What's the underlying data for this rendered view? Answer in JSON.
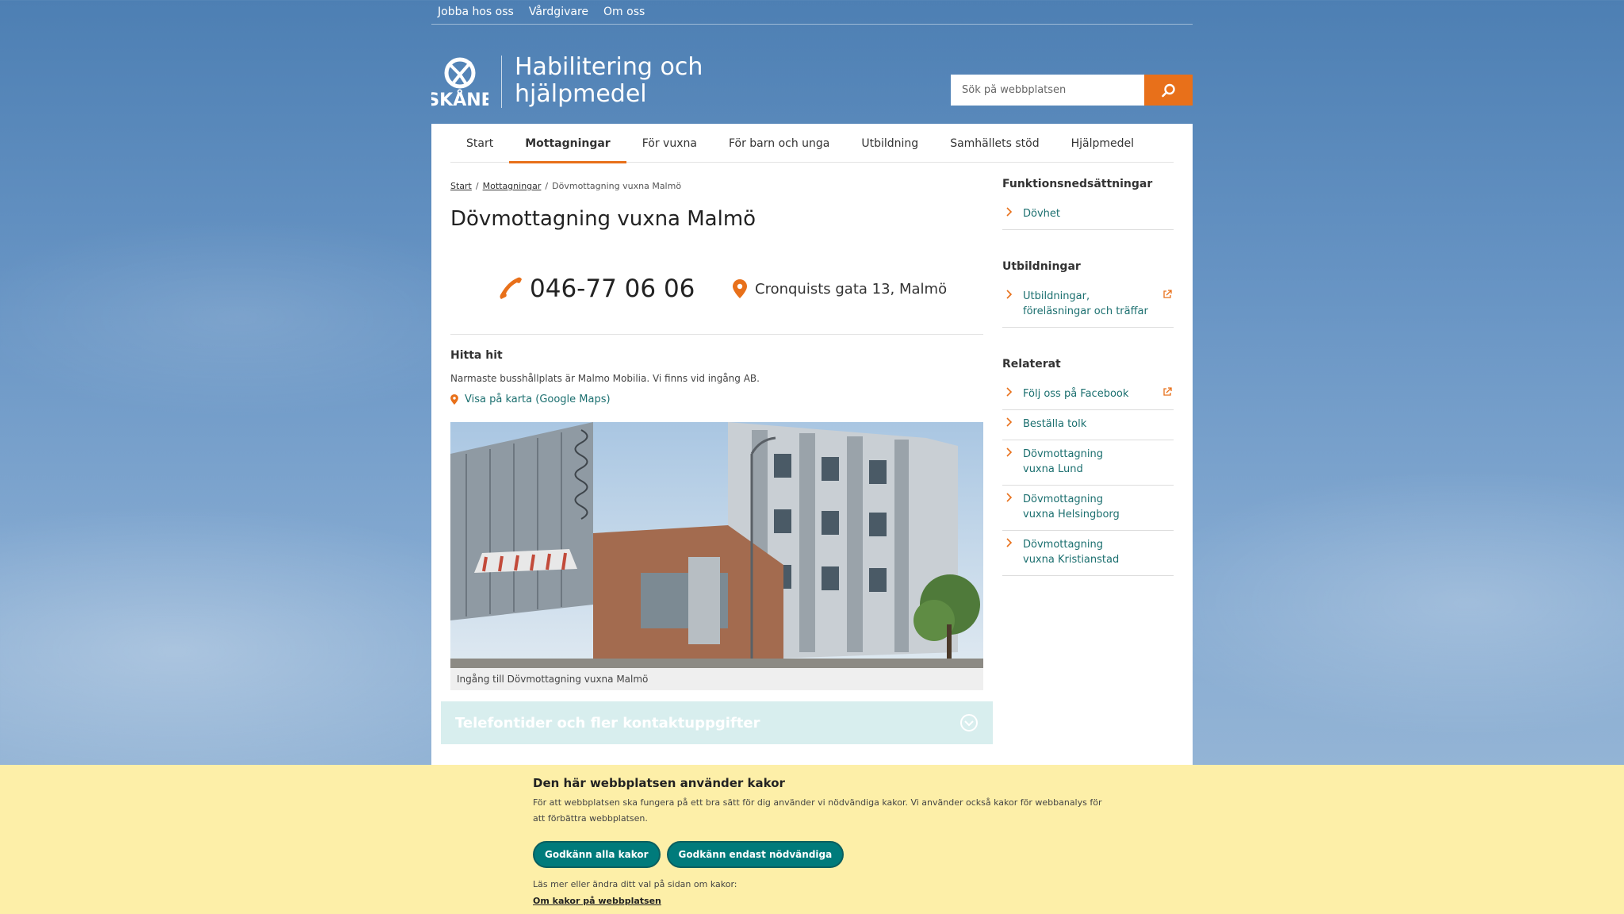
{
  "toplinks": [
    "Jobba hos oss",
    "Vårdgivare",
    "Om oss"
  ],
  "header": {
    "logo_text": "SKÅNE",
    "title": "Habilitering och hjälpmedel",
    "search_placeholder": "Sök på webbplatsen"
  },
  "nav": [
    "Start",
    "Mottagningar",
    "För vuxna",
    "För barn och unga",
    "Utbildning",
    "Samhällets stöd",
    "Hjälpmedel"
  ],
  "nav_active": "Mottagningar",
  "breadcrumb": {
    "items": [
      "Start",
      "Mottagningar"
    ],
    "current": "Dövmottagning vuxna Malmö"
  },
  "page_title": "Dövmottagning vuxna Malmö",
  "contact": {
    "phone": "046-77 06 06",
    "address": "Cronquists gata 13, Malmö"
  },
  "find_here": {
    "heading": "Hitta hit",
    "text": "Narmaste busshållplats är Malmo Mobilia. Vi finns vid ingång AB.",
    "map_link": "Visa på karta (Google Maps)"
  },
  "photo_caption": "Ingång till Dövmottagning vuxna Malmö",
  "accordion_label": "Telefontider och fler kontaktuppgifter",
  "sidebar": {
    "groups": [
      {
        "heading": "Funktionsnedsättningar",
        "items": [
          {
            "label": "Dövhet",
            "external": false
          }
        ]
      },
      {
        "heading": "Utbildningar",
        "items": [
          {
            "label": "Utbildningar, föreläsningar och träffar",
            "external": true
          }
        ]
      },
      {
        "heading": "Relaterat",
        "items": [
          {
            "label": "Följ oss på Facebook",
            "external": true
          },
          {
            "label": "Beställa tolk",
            "external": false
          },
          {
            "label": "Dövmottagning vuxna Lund",
            "external": false
          },
          {
            "label": "Dövmottagning vuxna Helsingborg",
            "external": false
          },
          {
            "label": "Dövmottagning vuxna Kristianstad",
            "external": false
          }
        ]
      }
    ]
  },
  "cookie": {
    "title": "Den här webbplatsen använder kakor",
    "text": "För att webbplatsen ska fungera på ett bra sätt för dig använder vi nödvändiga kakor. Vi använder också kakor för webbanalys för att förbättra webbplatsen.",
    "accept_all": "Godkänn alla kakor",
    "accept_necessary": "Godkänn endast nödvändiga",
    "more_text": "Läs mer eller ändra ditt val på sidan om kakor:",
    "more_link": "Om kakor på webbplatsen"
  },
  "colors": {
    "accent": "#e8701a",
    "link": "#1b6f6f",
    "button": "#007b7b",
    "cookie_bg": "#fdefa8"
  },
  "icons": [
    "search-icon",
    "phone-icon",
    "location-pin-icon",
    "chevron-right-icon",
    "external-link-icon",
    "chevron-down-circle-icon"
  ]
}
